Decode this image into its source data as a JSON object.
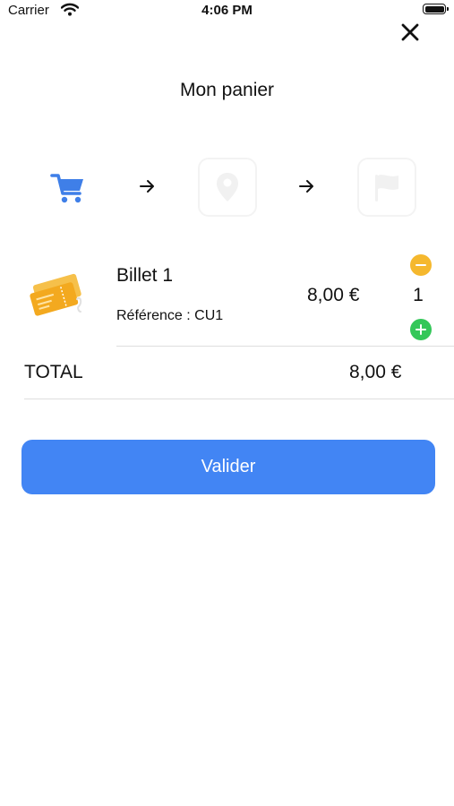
{
  "status_bar": {
    "carrier": "Carrier",
    "time": "4:06 PM"
  },
  "header": {
    "title": "Mon panier"
  },
  "stepper": {
    "steps": [
      {
        "icon": "cart-icon",
        "active": true
      },
      {
        "icon": "location-pin-icon",
        "active": false
      },
      {
        "icon": "flag-icon",
        "active": false
      }
    ]
  },
  "cart": {
    "items": [
      {
        "name": "Billet 1",
        "reference": "Référence : CU1",
        "price": "8,00 €",
        "quantity": "1",
        "icon": "ticket-icon"
      }
    ],
    "total_label": "TOTAL",
    "total_value": "8,00 €"
  },
  "actions": {
    "validate_label": "Valider"
  },
  "colors": {
    "accent": "#4285f4",
    "minus": "#f5b82e",
    "plus": "#34c759",
    "ticket": "#f5b32e"
  }
}
